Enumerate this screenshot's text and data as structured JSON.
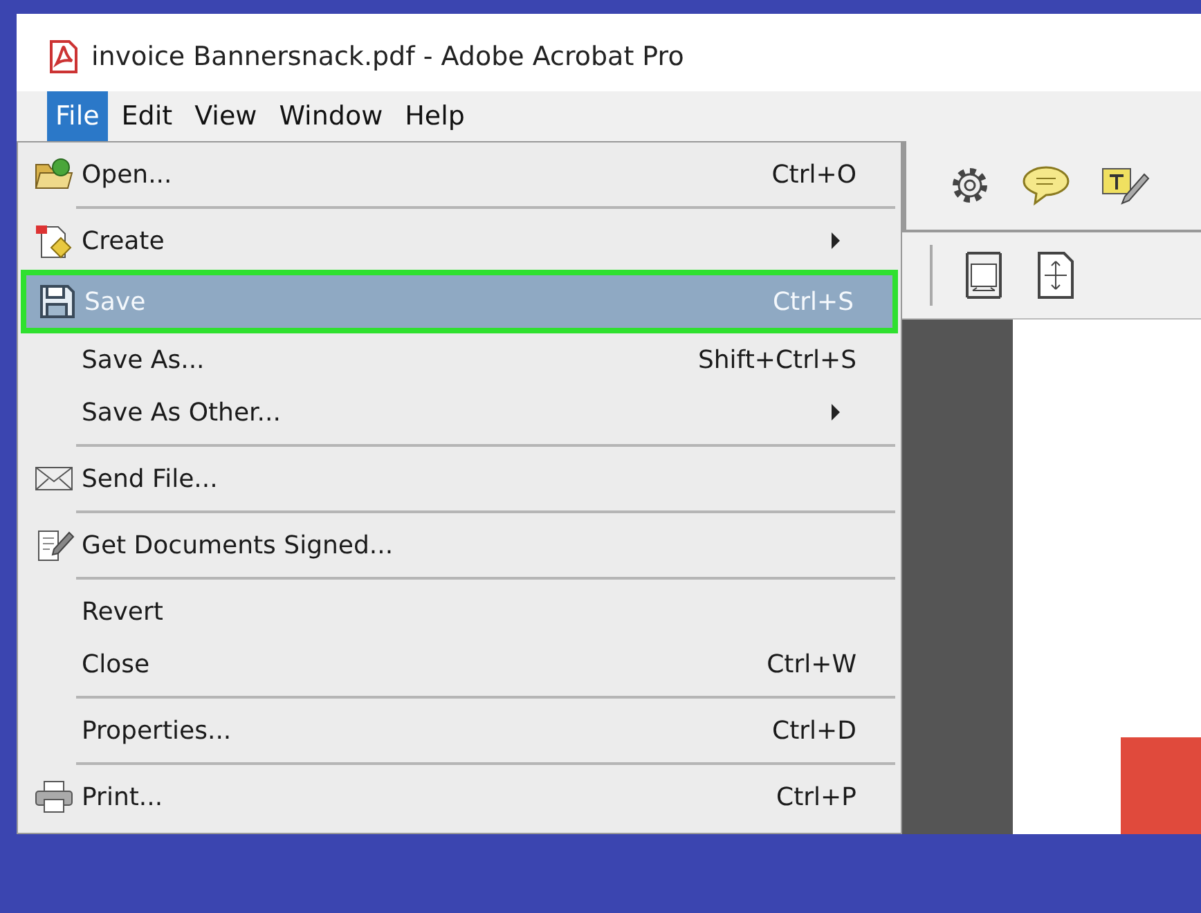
{
  "window": {
    "title": "invoice Bannersnack.pdf - Adobe Acrobat Pro"
  },
  "menubar": [
    {
      "label": "File",
      "selected": true
    },
    {
      "label": "Edit",
      "selected": false
    },
    {
      "label": "View",
      "selected": false
    },
    {
      "label": "Window",
      "selected": false
    },
    {
      "label": "Help",
      "selected": false
    }
  ],
  "file_menu": [
    {
      "kind": "item",
      "label": "Open...",
      "shortcut": "Ctrl+O",
      "submenu": false,
      "selected": false
    },
    {
      "kind": "separator"
    },
    {
      "kind": "item",
      "label": "Create",
      "submenu": true,
      "selected": false
    },
    {
      "kind": "item",
      "label": "Save",
      "shortcut": "Ctrl+S",
      "submenu": false,
      "selected": true
    },
    {
      "kind": "item",
      "label": "Save As...",
      "shortcut": "Shift+Ctrl+S",
      "submenu": false,
      "selected": false
    },
    {
      "kind": "item",
      "label": "Save As Other...",
      "submenu": true,
      "selected": false
    },
    {
      "kind": "separator"
    },
    {
      "kind": "item",
      "label": "Send File...",
      "submenu": false,
      "selected": false
    },
    {
      "kind": "separator"
    },
    {
      "kind": "item",
      "label": "Get Documents Signed...",
      "submenu": false,
      "selected": false
    },
    {
      "kind": "separator"
    },
    {
      "kind": "item",
      "label": "Revert",
      "submenu": false,
      "selected": false
    },
    {
      "kind": "item",
      "label": "Close",
      "shortcut": "Ctrl+W",
      "submenu": false,
      "selected": false
    },
    {
      "kind": "separator"
    },
    {
      "kind": "item",
      "label": "Properties...",
      "shortcut": "Ctrl+D",
      "submenu": false,
      "selected": false
    },
    {
      "kind": "separator"
    },
    {
      "kind": "item",
      "label": "Print...",
      "shortcut": "Ctrl+P",
      "submenu": false,
      "selected": false
    }
  ]
}
